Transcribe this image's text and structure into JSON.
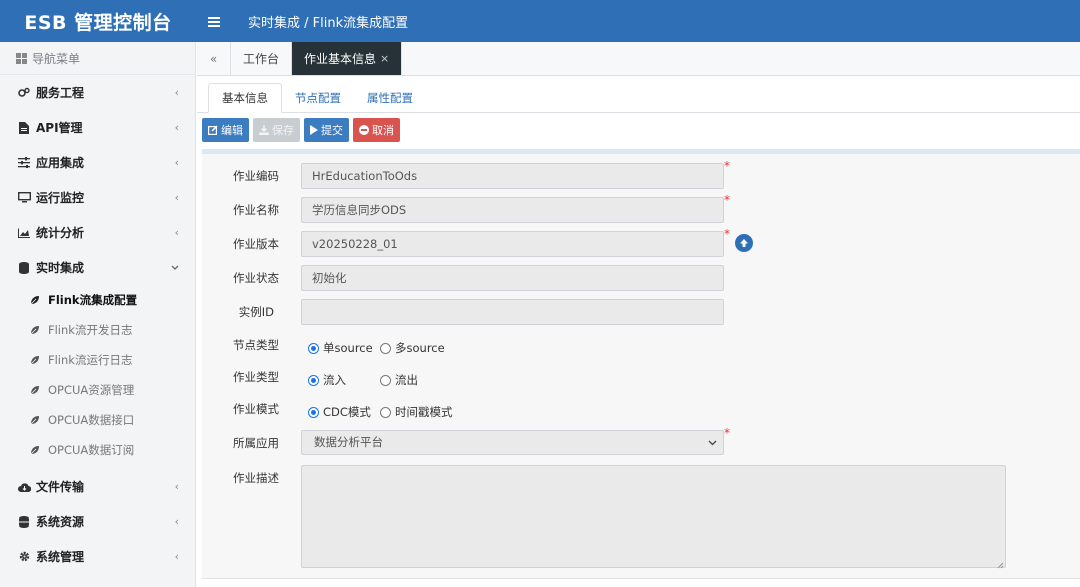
{
  "app": {
    "title": "ESB 管理控制台",
    "breadcrumb": "实时集成 / Flink流集成配置",
    "menu_icon": "hamburger-icon"
  },
  "sidebar": {
    "header": "导航菜单",
    "items": [
      {
        "label": "服务工程",
        "icon": "gears-icon"
      },
      {
        "label": "API管理",
        "icon": "file-icon"
      },
      {
        "label": "应用集成",
        "icon": "sliders-icon"
      },
      {
        "label": "运行监控",
        "icon": "monitor-icon"
      },
      {
        "label": "统计分析",
        "icon": "area-chart-icon"
      },
      {
        "label": "实时集成",
        "icon": "database-icon"
      }
    ],
    "subitems": [
      {
        "label": "Flink流集成配置",
        "active": true
      },
      {
        "label": "Flink流开发日志"
      },
      {
        "label": "Flink流运行日志"
      },
      {
        "label": "OPCUA资源管理"
      },
      {
        "label": "OPCUA数据接口"
      },
      {
        "label": "OPCUA数据订阅"
      }
    ],
    "bottom_items": [
      {
        "label": "文件传输",
        "icon": "cloud-icon"
      },
      {
        "label": "系统资源",
        "icon": "database-icon"
      },
      {
        "label": "系统管理",
        "icon": "gear-icon"
      }
    ],
    "chevron_closed": "‹",
    "chevron_open": "⌄"
  },
  "tabs": {
    "back": "«",
    "items": [
      {
        "label": "工作台"
      },
      {
        "label": "作业基本信息",
        "close": "×"
      }
    ]
  },
  "subtabs": [
    "基本信息",
    "节点配置",
    "属性配置"
  ],
  "toolbar": {
    "edit": "编辑",
    "save": "保存",
    "submit": "提交",
    "cancel": "取消"
  },
  "form": {
    "job_code": {
      "label": "作业编码",
      "value": "HrEducationToOds",
      "required": "*"
    },
    "job_name": {
      "label": "作业名称",
      "value": "学历信息同步ODS",
      "required": "*"
    },
    "job_version": {
      "label": "作业版本",
      "value": "v20250228_01",
      "required": "*"
    },
    "job_status": {
      "label": "作业状态",
      "value": "初始化"
    },
    "instance_id": {
      "label": "实例ID",
      "value": ""
    },
    "node_type": {
      "label": "节点类型",
      "options": [
        "单source",
        "多source"
      ],
      "selected": "单source"
    },
    "job_type": {
      "label": "作业类型",
      "options": [
        "流入",
        "流出"
      ],
      "selected": "流入"
    },
    "job_mode": {
      "label": "作业模式",
      "options": [
        "CDC模式",
        "时间戳模式"
      ],
      "selected": "CDC模式"
    },
    "app": {
      "label": "所属应用",
      "value": "数据分析平台",
      "required": "*"
    },
    "description": {
      "label": "作业描述",
      "value": ""
    }
  }
}
